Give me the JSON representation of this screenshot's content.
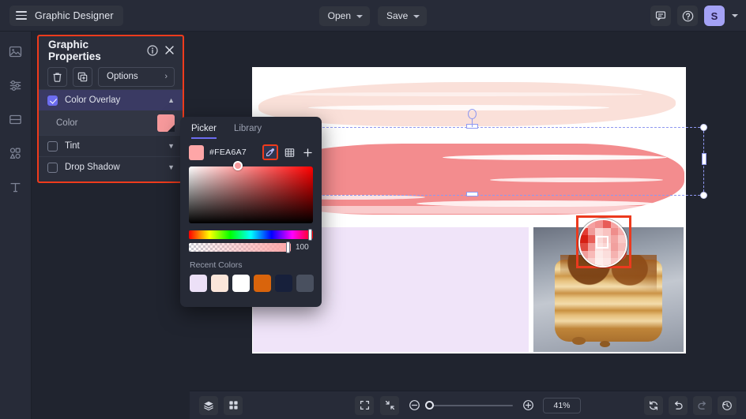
{
  "app": {
    "brand_title": "Graphic Designer",
    "menu_icon": "hamburger-icon"
  },
  "topbar": {
    "open_label": "Open",
    "save_label": "Save",
    "comment_icon": "comment-icon",
    "help_icon": "help-circle-icon",
    "avatar_initial": "S",
    "avatar_color": "#a4a2f5"
  },
  "rail": {
    "items": [
      {
        "icon": "image-icon",
        "name": "sidebar-item-images"
      },
      {
        "icon": "adjustments-icon",
        "name": "sidebar-item-adjustments"
      },
      {
        "icon": "layout-icon",
        "name": "sidebar-item-layouts"
      },
      {
        "icon": "shapes-icon",
        "name": "sidebar-item-shapes"
      },
      {
        "icon": "text-icon",
        "name": "sidebar-item-text"
      }
    ]
  },
  "properties_panel": {
    "title": "Graphic Properties",
    "info_icon": "info-circle-icon",
    "close_icon": "close-icon",
    "delete_icon": "trash-icon",
    "duplicate_icon": "duplicate-icon",
    "options_label": "Options",
    "options_chevron": "chevron-right-icon",
    "highlight_color": "#ef3b1c",
    "rows": [
      {
        "label": "Color Overlay",
        "checked": true,
        "expanded": true,
        "chevron": "chevron-up-icon"
      },
      {
        "label": "Tint",
        "checked": false,
        "expanded": false,
        "chevron": "chevron-down-icon"
      },
      {
        "label": "Drop Shadow",
        "checked": false,
        "expanded": false,
        "chevron": "chevron-down-icon"
      }
    ],
    "color_row": {
      "label": "Color",
      "swatch_color": "#f79a9c"
    }
  },
  "color_picker": {
    "tabs": [
      {
        "label": "Picker",
        "selected": true
      },
      {
        "label": "Library",
        "selected": false
      }
    ],
    "hex_value": "#FEA6A7",
    "swatch_color": "#fea6a7",
    "tools": [
      {
        "icon": "eyedropper-icon",
        "active": true
      },
      {
        "icon": "grid-icon",
        "active": false
      },
      {
        "icon": "plus-icon",
        "active": false
      }
    ],
    "alpha_value": "100",
    "recent_title": "Recent Colors",
    "recent_colors": [
      "#ece0f7",
      "#fbe6da",
      "#ffffff",
      "#d9640c",
      "#17203b",
      "#49505f"
    ]
  },
  "canvas": {
    "artboard_background": "#ffffff",
    "brush_light_color": "#fadfd7",
    "brush_dark_color": "#f38c8e",
    "lavender_color": "#f0e4f9",
    "selection_color": "#8f98f0",
    "eyedropper_marker_color": "#ec3a1e",
    "magnifier_pixels": [
      "#f8b0ae",
      "#f6a0a0",
      "#f2908f",
      "#e85c58",
      "#f5a4a3",
      "#f8bfbd",
      "#e43c33",
      "#f09b99",
      "#fbd3d1",
      "#f9c3c1",
      "#ef8d8b",
      "#f6aeac",
      "#d61f13",
      "#e85e57",
      "#fbdad8",
      "#f7c6c4",
      "#f3a5a3",
      "#f9c9c7",
      "#e04a40",
      "#f29e9c",
      "#fde2e0",
      "#fad5d3",
      "#f1a09e",
      "#f7bcba",
      "#f29d9b",
      "#f8bab8",
      "#fceae8",
      "#fbdedc",
      "#f5b2b0",
      "#fad0ce",
      "#f7b8b6",
      "#fad0ce",
      "#fdeeec",
      "#fce6e4",
      "#f8c5c3",
      "#fbd9d7"
    ]
  },
  "bottombar": {
    "layers_icon": "layers-icon",
    "grid_icon": "grid-view-icon",
    "fit_icon": "fit-screen-icon",
    "collapse_icon": "collapse-icon",
    "zoom_out_icon": "zoom-out-icon",
    "zoom_in_icon": "zoom-in-icon",
    "zoom_value": "41%",
    "refresh_icon": "refresh-icon",
    "undo_icon": "undo-icon",
    "redo_icon": "redo-icon",
    "history_icon": "history-icon"
  }
}
